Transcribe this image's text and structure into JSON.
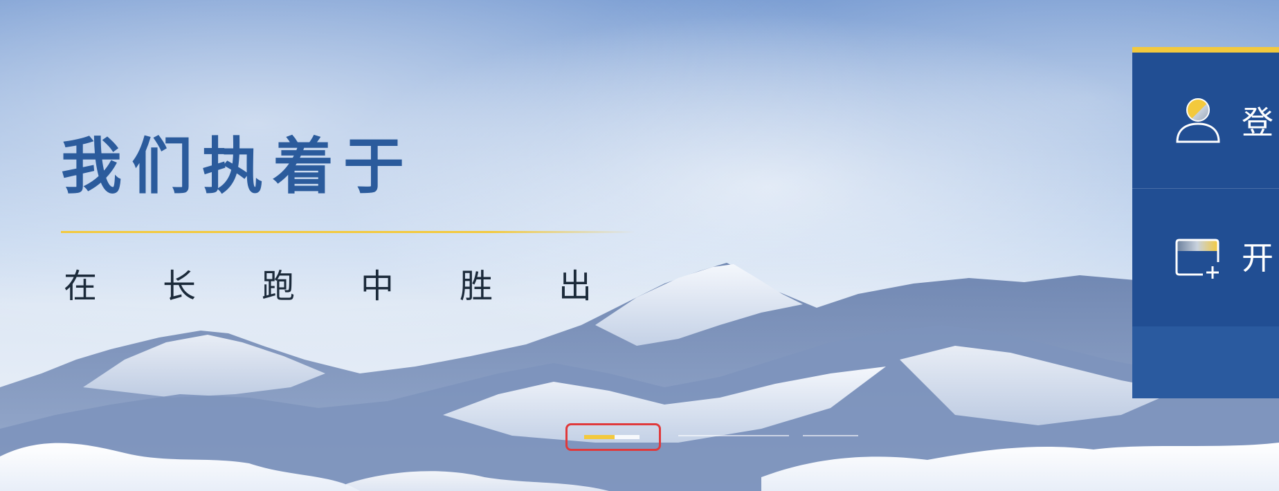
{
  "hero": {
    "headline": "我们执着于",
    "subline_chars": [
      "在",
      "长",
      "跑",
      "中",
      "胜",
      "出"
    ]
  },
  "side_panel": {
    "login_label": "登",
    "open_label": "开",
    "login_icon": "user-icon",
    "open_icon": "card-add-icon"
  },
  "carousel": {
    "active_progress": 0.55
  },
  "colors": {
    "accent_yellow": "#f3c93d",
    "panel_blue": "#214e93",
    "headline_blue": "#2b5b9c",
    "highlight_red": "#e0393b"
  }
}
